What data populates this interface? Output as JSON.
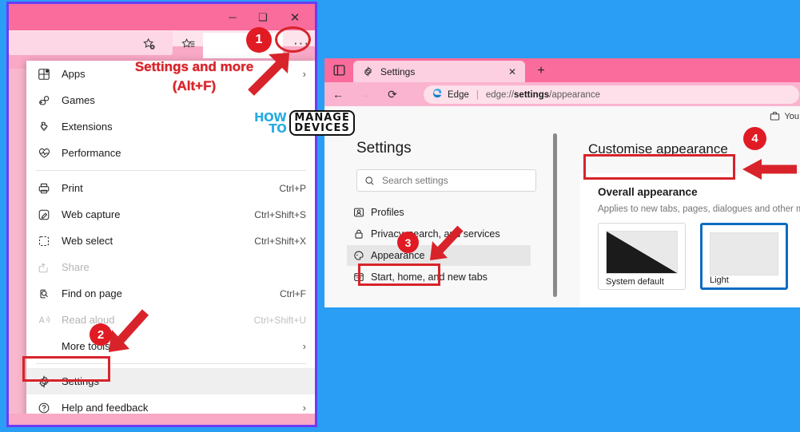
{
  "colors": {
    "desktop_blue": "#2a9df4",
    "titlebar_pink": "#fa6c9c",
    "toolbar_pink": "#f9a8c6",
    "window_border_purple": "#6a3df5",
    "annotation_red": "#d8232a",
    "badge_red": "#e01b24",
    "selected_blue": "#0f6cbd",
    "watermark_cyan": "#29abe2"
  },
  "left_window": {
    "window_controls": {
      "minimize": "─",
      "maximize": "❑",
      "close": "✕"
    },
    "toolbar": {
      "favorite_add_icon": "star-plus-icon",
      "favorites_icon": "favorites-star-list-icon",
      "more_button_label": "···",
      "more_button_name": "settings-and-more-button"
    },
    "menu": {
      "groups": [
        {
          "items": [
            {
              "icon": "apps-icon",
              "label": "Apps",
              "accel": "",
              "chevron": true,
              "disabled": false
            },
            {
              "icon": "games-icon",
              "label": "Games",
              "accel": "",
              "chevron": false,
              "disabled": false
            },
            {
              "icon": "extensions-icon",
              "label": "Extensions",
              "accel": "",
              "chevron": false,
              "disabled": false
            },
            {
              "icon": "performance-icon",
              "label": "Performance",
              "accel": "",
              "chevron": false,
              "disabled": false
            }
          ]
        },
        {
          "items": [
            {
              "icon": "print-icon",
              "label": "Print",
              "accel": "Ctrl+P",
              "chevron": false,
              "disabled": false
            },
            {
              "icon": "web-capture-icon",
              "label": "Web capture",
              "accel": "Ctrl+Shift+S",
              "chevron": false,
              "disabled": false
            },
            {
              "icon": "web-select-icon",
              "label": "Web select",
              "accel": "Ctrl+Shift+X",
              "chevron": false,
              "disabled": false
            },
            {
              "icon": "share-icon",
              "label": "Share",
              "accel": "",
              "chevron": false,
              "disabled": true
            },
            {
              "icon": "find-icon",
              "label": "Find on page",
              "accel": "Ctrl+F",
              "chevron": false,
              "disabled": false
            },
            {
              "icon": "read-aloud-icon",
              "label": "Read aloud",
              "accel": "Ctrl+Shift+U",
              "chevron": false,
              "disabled": true
            },
            {
              "icon": "more-tools-icon",
              "label": "More tools",
              "accel": "",
              "chevron": true,
              "disabled": false
            }
          ]
        },
        {
          "items": [
            {
              "icon": "gear-icon",
              "label": "Settings",
              "accel": "",
              "chevron": false,
              "disabled": false,
              "highlighted": true
            },
            {
              "icon": "help-icon",
              "label": "Help and feedback",
              "accel": "",
              "chevron": true,
              "disabled": false
            }
          ]
        }
      ]
    }
  },
  "right_window": {
    "tabbar": {
      "tab_actions_icon": "tab-actions-icon",
      "tab": {
        "icon": "gear-icon",
        "title": "Settings",
        "close": "✕"
      },
      "new_tab": "+"
    },
    "addressbar": {
      "back": "←",
      "forward": "→",
      "refresh": "⟳",
      "site_icon": "edge-logo-icon",
      "brand": "Edge",
      "divider": "|",
      "url_prefix": "edge://",
      "url_bold": "settings",
      "url_suffix": "/appearance"
    },
    "managed_note": {
      "icon": "briefcase-icon",
      "text": "You"
    },
    "settings_panel": {
      "title": "Settings",
      "search": {
        "icon": "search-icon",
        "placeholder": "Search settings"
      },
      "nav_items": [
        {
          "icon": "profiles-icon",
          "label": "Profiles",
          "active": false
        },
        {
          "icon": "lock-icon",
          "label": "Privacy, search, and services",
          "active": false
        },
        {
          "icon": "appearance-icon",
          "label": "Appearance",
          "active": true
        },
        {
          "icon": "start-home-icon",
          "label": "Start, home, and new tabs",
          "active": false
        }
      ]
    },
    "main_pane": {
      "heading": "Customise appearance",
      "card": {
        "title": "Overall appearance",
        "subtitle": "Applies to new tabs, pages, dialogues and other me",
        "themes": [
          {
            "label": "System default",
            "selected": false
          },
          {
            "label": "Light",
            "selected": true
          }
        ]
      }
    }
  },
  "annotations": {
    "badges": [
      {
        "id": "1",
        "label": "1"
      },
      {
        "id": "2",
        "label": "2"
      },
      {
        "id": "3",
        "label": "3"
      },
      {
        "id": "4",
        "label": "4"
      }
    ],
    "callout": {
      "line1": "Settings and more",
      "line2": "(Alt+F)"
    }
  },
  "watermark": {
    "how": "HOW",
    "to": "TO",
    "manage": "MANAGE",
    "devices": "DEVICES"
  }
}
